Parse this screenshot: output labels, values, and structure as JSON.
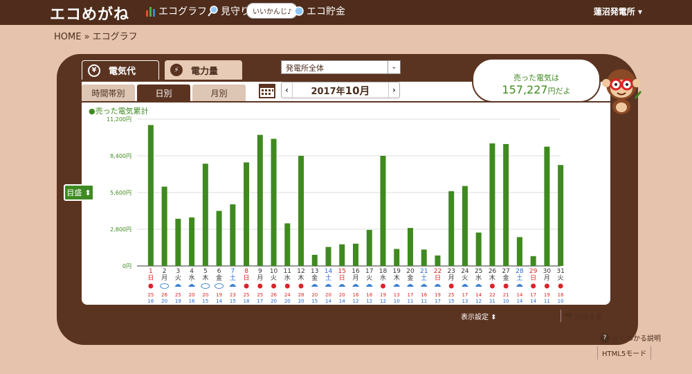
{
  "header": {
    "logo": "エコめがね",
    "nav": [
      {
        "label": "エコグラフ",
        "icon": "bar-chart-icon"
      },
      {
        "label": "見守り",
        "icon": "magnifier-icon"
      },
      {
        "label": "エコ貯金",
        "icon": "coin-icon"
      }
    ],
    "speech": "いいかんじ♪",
    "plant_menu": "蓮沼発電所 ▾"
  },
  "breadcrumb": "HOME » エコグラフ",
  "main_tabs": [
    {
      "label": "電気代",
      "icon": "yen-icon",
      "active": true
    },
    {
      "label": "電力量",
      "icon": "lightning-icon",
      "active": false
    }
  ],
  "plant_select": {
    "value": "発電所全体"
  },
  "sub_tabs": [
    {
      "label": "時間帯別",
      "active": false
    },
    {
      "label": "日別",
      "active": true
    },
    {
      "label": "月別",
      "active": false
    }
  ],
  "month": {
    "prefix": "2017年",
    "month": "10月",
    "prev": "‹",
    "next": "›"
  },
  "sold_summary": {
    "line1": "売った電気は",
    "amount": "157,227",
    "unit": "円だよ"
  },
  "legend": "●売った電気累計",
  "scale_button": "目盛",
  "chart_data": {
    "type": "bar",
    "title": "",
    "legend": "売った電気累計",
    "yticks": [
      "0円",
      "2,800円",
      "5,600円",
      "8,400円",
      "11,200円"
    ],
    "ylim": [
      0,
      11200
    ],
    "color": "#3f8a1f",
    "x": [
      "1",
      "2",
      "3",
      "4",
      "5",
      "6",
      "7",
      "8",
      "9",
      "10",
      "11",
      "12",
      "13",
      "14",
      "15",
      "16",
      "17",
      "18",
      "19",
      "20",
      "21",
      "22",
      "23",
      "24",
      "25",
      "26",
      "27",
      "28",
      "29",
      "30",
      "31"
    ],
    "weekday": [
      "日",
      "月",
      "火",
      "水",
      "木",
      "金",
      "土",
      "日",
      "月",
      "火",
      "水",
      "木",
      "金",
      "土",
      "日",
      "月",
      "火",
      "水",
      "木",
      "金",
      "土",
      "日",
      "月",
      "火",
      "水",
      "木",
      "金",
      "土",
      "日",
      "月",
      "火"
    ],
    "values": [
      10750,
      6050,
      3600,
      3700,
      7800,
      4200,
      4700,
      7900,
      10000,
      9700,
      3250,
      8400,
      850,
      1450,
      1650,
      1700,
      2750,
      8400,
      1300,
      2900,
      1250,
      800,
      5700,
      6100,
      2550,
      9350,
      9300,
      2200,
      750,
      9100,
      7700
    ],
    "weather": [
      "sun",
      "cloud",
      "umbrella",
      "umbrella",
      "cloud",
      "cloud",
      "umbrella",
      "sun",
      "sun",
      "sun",
      "sun",
      "sun",
      "umbrella",
      "umbrella",
      "umbrella",
      "umbrella",
      "umbrella",
      "sun",
      "umbrella",
      "umbrella",
      "umbrella",
      "umbrella",
      "sun",
      "umbrella",
      "umbrella",
      "sun",
      "sun",
      "umbrella",
      "sun",
      "sun",
      "sun"
    ],
    "high": [
      "25",
      "26",
      "25",
      "20",
      "20",
      "19",
      "23",
      "25",
      "25",
      "26",
      "24",
      "28",
      "20",
      "20",
      "20",
      "16",
      "16",
      "19",
      "13",
      "17",
      "16",
      "19",
      "25",
      "17",
      "14",
      "22",
      "21",
      "14",
      "17",
      "19",
      "16"
    ],
    "low": [
      "16",
      "20",
      "19",
      "16",
      "15",
      "14",
      "15",
      "18",
      "17",
      "20",
      "20",
      "20",
      "15",
      "14",
      "14",
      "12",
      "12",
      "12",
      "10",
      "11",
      "11",
      "17",
      "15",
      "13",
      "12",
      "11",
      "10",
      "14",
      "14",
      "11",
      "10"
    ]
  },
  "footer": {
    "display_settings": "表示設定 ⬍",
    "print": "印刷する",
    "help": "よくわかる説明",
    "html5": "HTML5モード"
  }
}
